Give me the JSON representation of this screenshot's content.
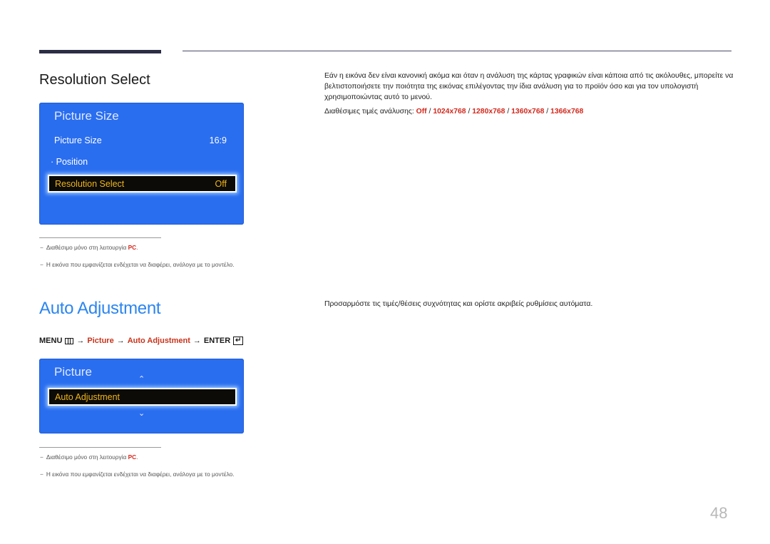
{
  "page": {
    "number": "48"
  },
  "resolution_section": {
    "title": "Resolution Select",
    "osd": {
      "title": "Picture Size",
      "rows": [
        {
          "label": "Picture Size",
          "value": "16:9"
        },
        {
          "label": "· Position",
          "value": ""
        }
      ],
      "selected": {
        "label": "Resolution Select",
        "value": "Off"
      }
    },
    "notes": [
      {
        "dash": "−",
        "text": "Διαθέσιμο μόνο στη λειτουργία ",
        "highlight": "PC",
        "suffix": "."
      },
      {
        "dash": "−",
        "text": "Η εικόνα που εμφανίζεται ενδέχεται να διαφέρει, ανάλογα με το μοντέλο."
      }
    ],
    "description": "Εάν η εικόνα δεν είναι κανονική ακόμα και όταν η ανάλυση της κάρτας γραφικών είναι κάποια από τις ακόλουθες, μπορείτε να βελτιστοποιήσετε την ποιότητα της εικόνας επιλέγοντας την ίδια ανάλυση για το προϊόν όσο και για τον υπολογιστή χρησιμοποιώντας αυτό το μενού.",
    "values_label": "Διαθέσιμες τιμές ανάλυσης: ",
    "values": [
      "Off",
      "1024x768",
      "1280x768",
      "1360x768",
      "1366x768"
    ],
    "separator": " / "
  },
  "auto_section": {
    "title": "Auto Adjustment",
    "menu_path": {
      "menu": "MENU",
      "arrow": "→",
      "picture": "Picture",
      "item": "Auto Adjustment",
      "enter": "ENTER",
      "menu_icon": "menu-icon",
      "enter_icon": "enter-icon"
    },
    "osd": {
      "title": "Picture",
      "up_icon": "chevron-up",
      "down_icon": "chevron-down",
      "selected": {
        "label": "Auto Adjustment"
      }
    },
    "notes": [
      {
        "dash": "−",
        "text": "Διαθέσιμο μόνο στη λειτουργία ",
        "highlight": "PC",
        "suffix": "."
      },
      {
        "dash": "−",
        "text": "Η εικόνα που εμφανίζεται ενδέχεται να διαφέρει, ανάλογα με το μοντέλο."
      }
    ],
    "description": "Προσαρμόστε τις τιμές/θέσεις συχνότητας και ορίστε ακριβείς ρυθμίσεις αυτόματα."
  }
}
